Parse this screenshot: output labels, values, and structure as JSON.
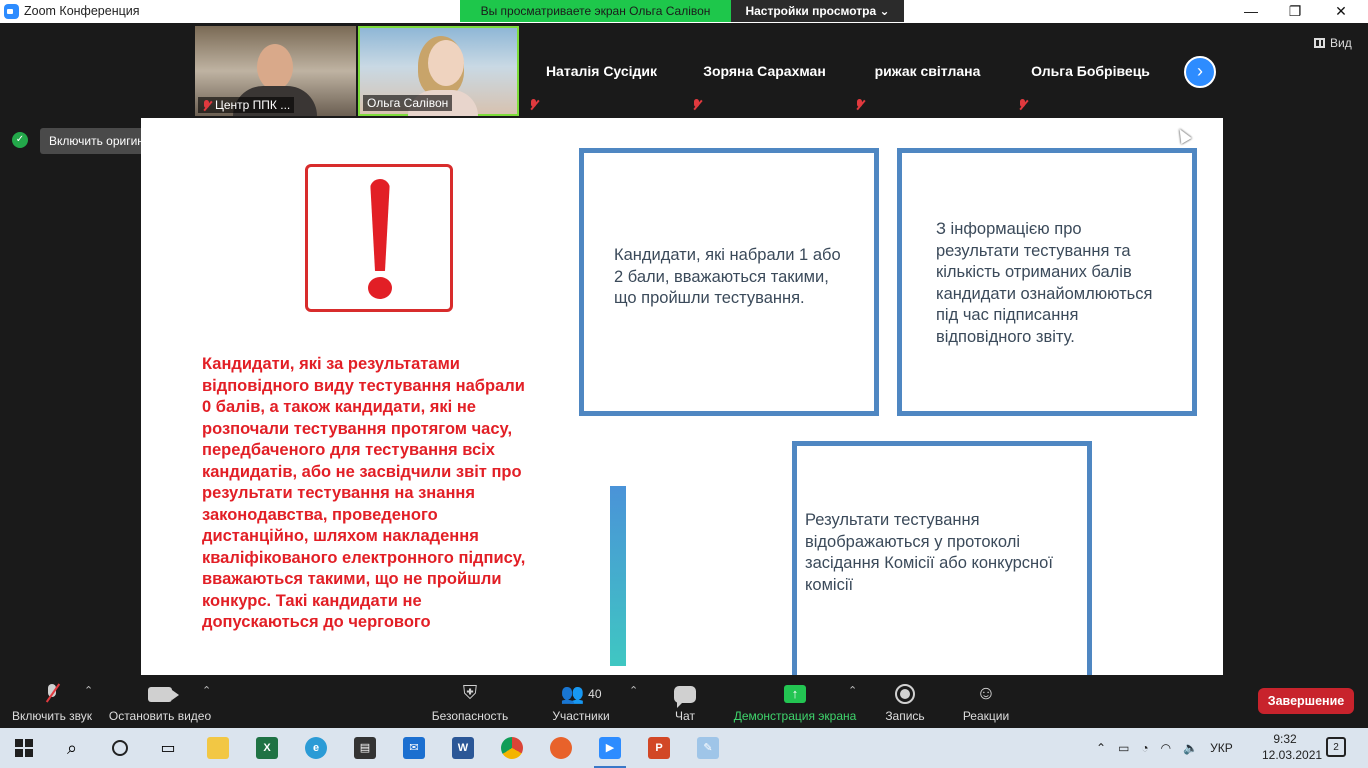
{
  "titlebar": {
    "title": "Zoom Конференция",
    "minimize": "—",
    "restore": "❐",
    "close": "✕"
  },
  "share_banner": {
    "viewing": "Вы просматриваете экран Ольга Салівон",
    "view_settings": "Настройки просмотра ⌄"
  },
  "participants": [
    {
      "name": "Центр ППК ...",
      "type": "video"
    },
    {
      "name": "Ольга Салівон",
      "type": "video"
    },
    {
      "name": "Наталія Сусідик",
      "type": "name"
    },
    {
      "name": "Зоряна Сарахман",
      "type": "name"
    },
    {
      "name": "рижак світлана",
      "type": "name"
    },
    {
      "name": "Ольга Бобрівець",
      "type": "name"
    }
  ],
  "view_label": "Вид",
  "original_sound_label": "Включить оригинальный звук",
  "slide": {
    "red_text": "Кандидати, які за результатами відповідного виду тестування набрали 0 балів, а також кандидати, які не розпочали тестування протягом часу, передбаченого для тестування всіх кандидатів, або не засвідчили звіт про результати тестування на знання законодавства, проведеного дистанційно, шляхом накладення кваліфікованого електронного підпису, вважаються такими, що не пройшли конкурс. Такі кандидати не допускаються до чергового",
    "box1": "Кандидати, які набрали 1 або 2 бали, вважаються такими, що пройшли тестування.",
    "box2": "З інформацією про результати тестування та кількість отриманих балів кандидати ознайомлюються під час підписання відповідного звіту.",
    "box3": "Результати тестування відображаються у протоколі засідання Комісії або конкурсної комісії"
  },
  "toolbar": {
    "unmute": "Включить звук",
    "stop_video": "Остановить видео",
    "security": "Безопасность",
    "participants": "Участники",
    "participants_count": "40",
    "chat": "Чат",
    "share_screen": "Демонстрация экрана",
    "record": "Запись",
    "reactions": "Реакции",
    "end": "Завершение"
  },
  "taskbar": {
    "apps": [
      "start-button",
      "search",
      "cortana",
      "task-view",
      "file-explorer",
      "excel",
      "edge",
      "store",
      "mail",
      "word",
      "chrome",
      "firefox",
      "zoom",
      "presentation",
      "paint"
    ],
    "lang": "УКР",
    "time": "9:32",
    "date": "12.03.2021",
    "notifications": "2"
  },
  "colors": {
    "accent_blue": "#2d8cff",
    "share_green": "#1ec74b",
    "end_red": "#c8232c",
    "slide_red": "#e21f26",
    "box_border": "#4f87c2"
  }
}
